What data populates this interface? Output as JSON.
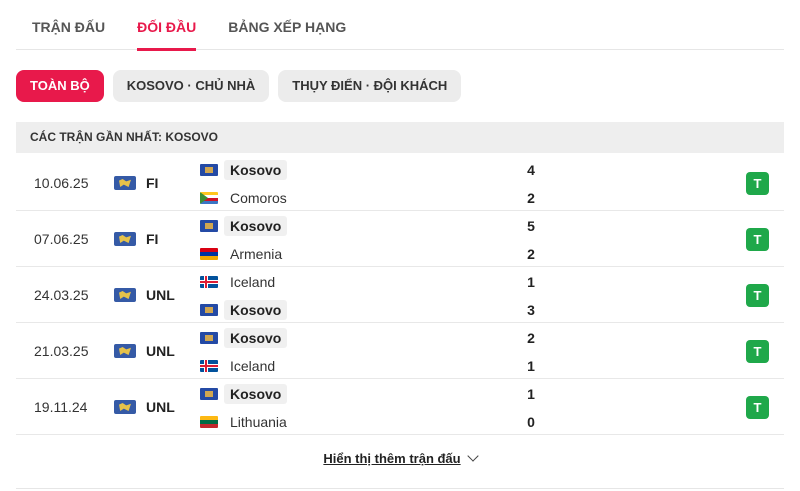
{
  "tabs": [
    {
      "label": "TRẬN ĐẤU",
      "active": false
    },
    {
      "label": "ĐỐI ĐẦU",
      "active": true
    },
    {
      "label": "BẢNG XẾP HẠNG",
      "active": false
    }
  ],
  "filters": [
    {
      "label": "TOÀN BỘ",
      "active": true
    },
    {
      "label": "KOSOVO · CHỦ NHÀ",
      "active": false
    },
    {
      "label": "THỤY ĐIỂN · ĐỘI KHÁCH",
      "active": false
    }
  ],
  "section_title": "CÁC TRẬN GẦN NHẤT: KOSOVO",
  "matches": [
    {
      "date": "10.06.25",
      "competition": "FI",
      "home": {
        "name": "Kosovo",
        "flag": "kosovo-flag",
        "score": "4"
      },
      "away": {
        "name": "Comoros",
        "flag": "comoros-flag",
        "score": "2"
      },
      "result": "T"
    },
    {
      "date": "07.06.25",
      "competition": "FI",
      "home": {
        "name": "Kosovo",
        "flag": "kosovo-flag",
        "score": "5"
      },
      "away": {
        "name": "Armenia",
        "flag": "armenia-flag",
        "score": "2"
      },
      "result": "T"
    },
    {
      "date": "24.03.25",
      "competition": "UNL",
      "home": {
        "name": "Iceland",
        "flag": "iceland-flag",
        "score": "1"
      },
      "away": {
        "name": "Kosovo",
        "flag": "kosovo-flag",
        "score": "3"
      },
      "result": "T"
    },
    {
      "date": "21.03.25",
      "competition": "UNL",
      "home": {
        "name": "Kosovo",
        "flag": "kosovo-flag",
        "score": "2"
      },
      "away": {
        "name": "Iceland",
        "flag": "iceland-flag",
        "score": "1"
      },
      "result": "T"
    },
    {
      "date": "19.11.24",
      "competition": "UNL",
      "home": {
        "name": "Kosovo",
        "flag": "kosovo-flag",
        "score": "1"
      },
      "away": {
        "name": "Lithuania",
        "flag": "lithuania-flag",
        "score": "0"
      },
      "result": "T"
    }
  ],
  "show_more": "Hiển thị thêm trận đấu",
  "colors": {
    "accent": "#e8194b",
    "win": "#1fa84a"
  }
}
